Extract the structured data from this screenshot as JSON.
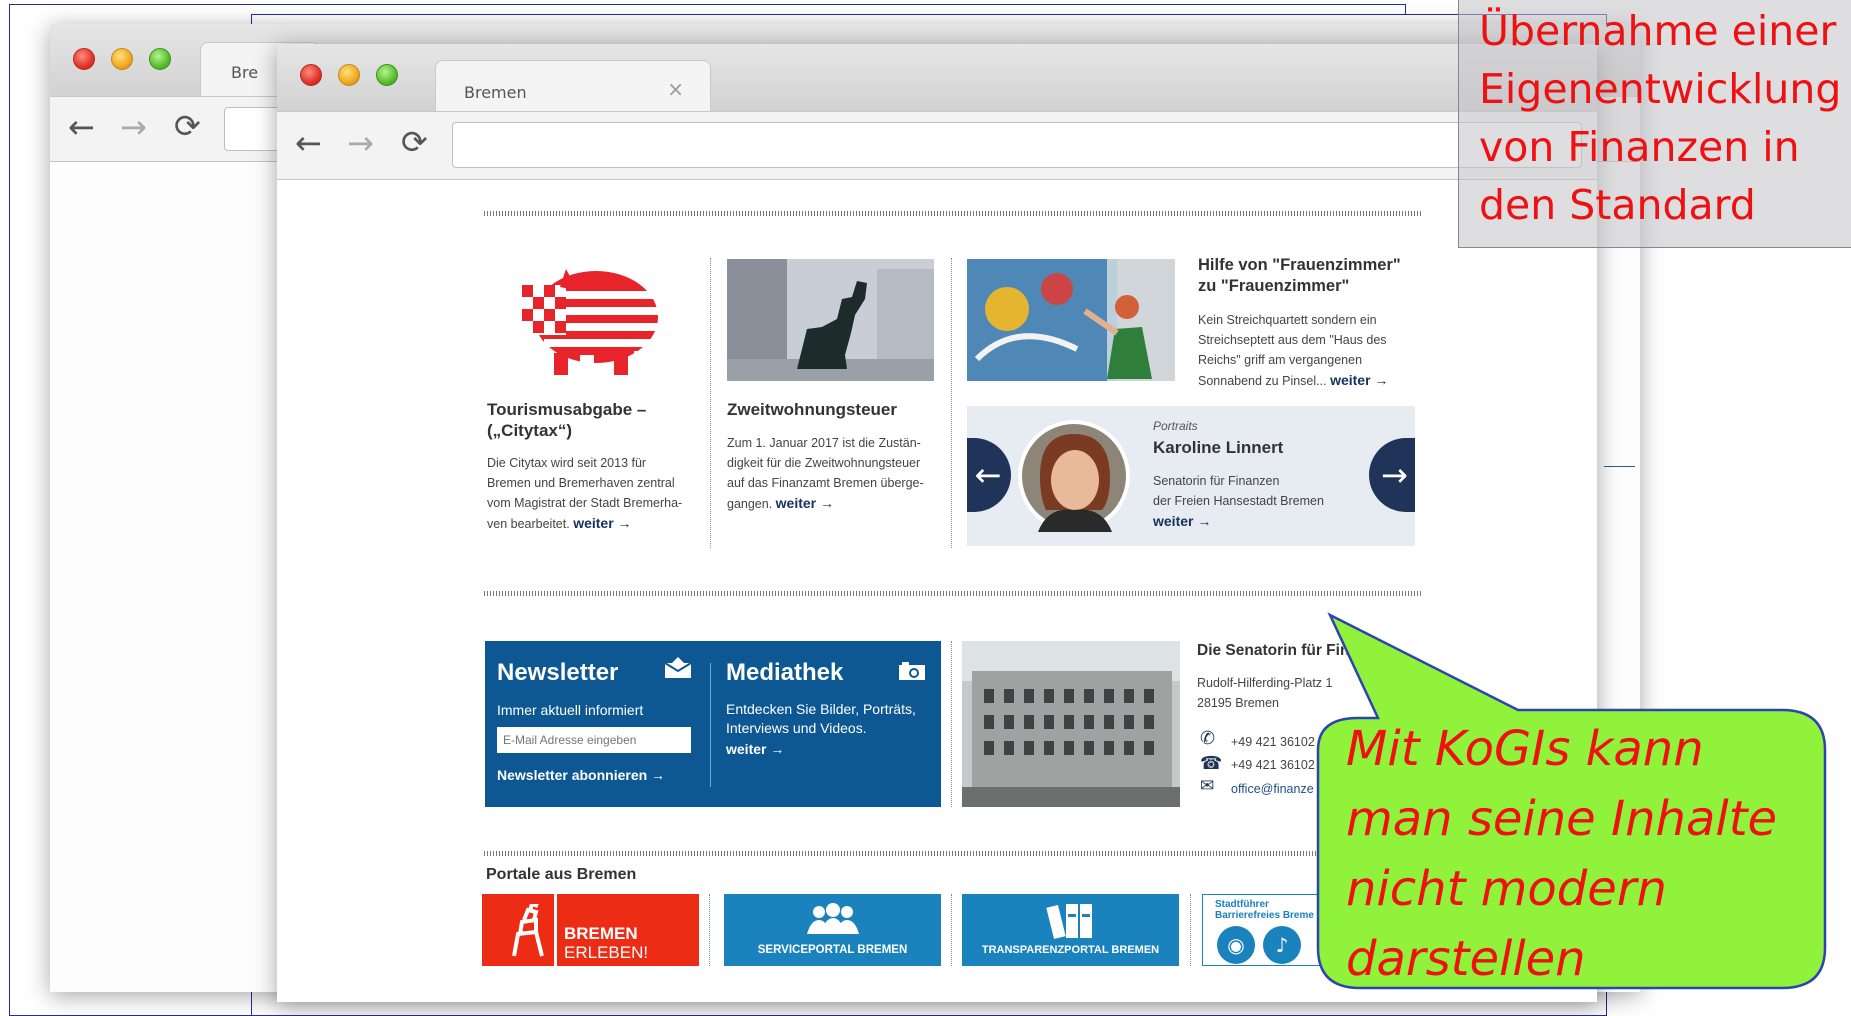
{
  "back_browser": {
    "tab_label": "Bre"
  },
  "main_browser": {
    "tab_label": "Bremen",
    "tab_close": "×"
  },
  "teasers": [
    {
      "title": "Tourismusabgabe –\n(„Citytax“)",
      "text": "Die Citytax wird seit 2013 für Bremen und Bremerhaven zentral vom Magistrat der Stadt Bremerha-ven bearbeitet.",
      "more": "weiter →"
    },
    {
      "title": "Zweitwohnungsteuer",
      "text": "Zum 1. Januar 2017 ist die Zustän-digkeit für die Zweitwohnungsteuer auf das Finanzamt Bremen überge-gangen.",
      "more": "weiter →"
    }
  ],
  "article": {
    "title": "Hilfe von \"Frauenzimmer\" zu \"Frauenzimmer\"",
    "text": "Kein Streichquartett sondern ein Streichseptett aus dem \"Haus des Reichs\" griff am vergangenen Sonnabend zu Pinsel...",
    "more": "weiter →"
  },
  "portrait": {
    "kicker": "Portraits",
    "name": "Karoline Linnert",
    "role1": "Senatorin für Finanzen",
    "role2": "der Freien Hansestadt Bremen",
    "more": "weiter →",
    "prev": "←",
    "next": "→"
  },
  "newsletter": {
    "title": "Newsletter",
    "subtitle": "Immer aktuell informiert",
    "placeholder": "E-Mail Adresse eingeben",
    "subscribe": "Newsletter abonnieren →"
  },
  "mediathek": {
    "title": "Mediathek",
    "text": "Entdecken Sie Bilder, Porträts, Interviews und Videos.",
    "more": "weiter →"
  },
  "contact": {
    "title": "Die Senatorin für Fin",
    "street": "Rudolf-Hilferding-Platz 1",
    "city": "28195 Bremen",
    "phone": "+49 421 36102",
    "fax": "+49 421 36102",
    "email": "office@finanze"
  },
  "portale": {
    "heading": "Portale aus Bremen",
    "items": [
      "BREMEN",
      "ERLEBEN!",
      "SERVICEPORTAL BREMEN",
      "TRANSPARENZPORTAL BREMEN",
      "Stadtführer",
      "Barrierefreies Breme"
    ]
  },
  "callouts": {
    "top_lines": [
      "Übernahme einer",
      "Eigenentwicklung",
      "von Finanzen in",
      "den Standard"
    ],
    "bubble_lines": [
      "Mit KoGIs kann",
      "man seine Inhalte",
      "nicht modern",
      "darstellen"
    ]
  },
  "colors": {
    "brand_blue": "#0d5793",
    "navy": "#1f3458",
    "bubble_green": "#90f23a",
    "callout_red": "#ee1111",
    "bremen_red": "#ec2c14"
  }
}
